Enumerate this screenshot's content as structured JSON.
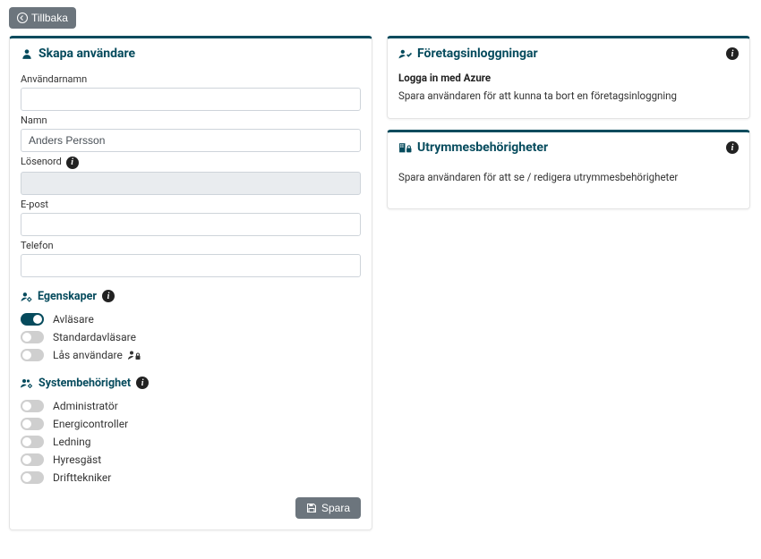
{
  "back_label": "Tillbaka",
  "left": {
    "title": "Skapa användare",
    "fields": {
      "username": {
        "label": "Användarnamn",
        "value": ""
      },
      "name": {
        "label": "Namn",
        "value": "Anders Persson"
      },
      "password": {
        "label": "Lösenord",
        "value": ""
      },
      "email": {
        "label": "E-post",
        "value": ""
      },
      "phone": {
        "label": "Telefon",
        "value": ""
      }
    },
    "properties": {
      "title": "Egenskaper",
      "items": [
        {
          "label": "Avläsare",
          "on": true
        },
        {
          "label": "Standardavläsare",
          "on": false
        },
        {
          "label": "Lås användare",
          "on": false,
          "icon": "user-lock"
        }
      ]
    },
    "sysperm": {
      "title": "Systembehörighet",
      "items": [
        {
          "label": "Administratör",
          "on": false
        },
        {
          "label": "Energicontroller",
          "on": false
        },
        {
          "label": "Ledning",
          "on": false
        },
        {
          "label": "Hyresgäst",
          "on": false
        },
        {
          "label": "Drifttekniker",
          "on": false
        }
      ]
    },
    "save_label": "Spara"
  },
  "right": {
    "enterprise": {
      "title": "Företagsinloggningar",
      "line1": "Logga in med Azure",
      "line2": "Spara användaren för att kunna ta bort en företagsinloggning"
    },
    "spaces": {
      "title": "Utrymmesbehörigheter",
      "line": "Spara användaren för att se / redigera utrymmesbehörigheter"
    }
  }
}
